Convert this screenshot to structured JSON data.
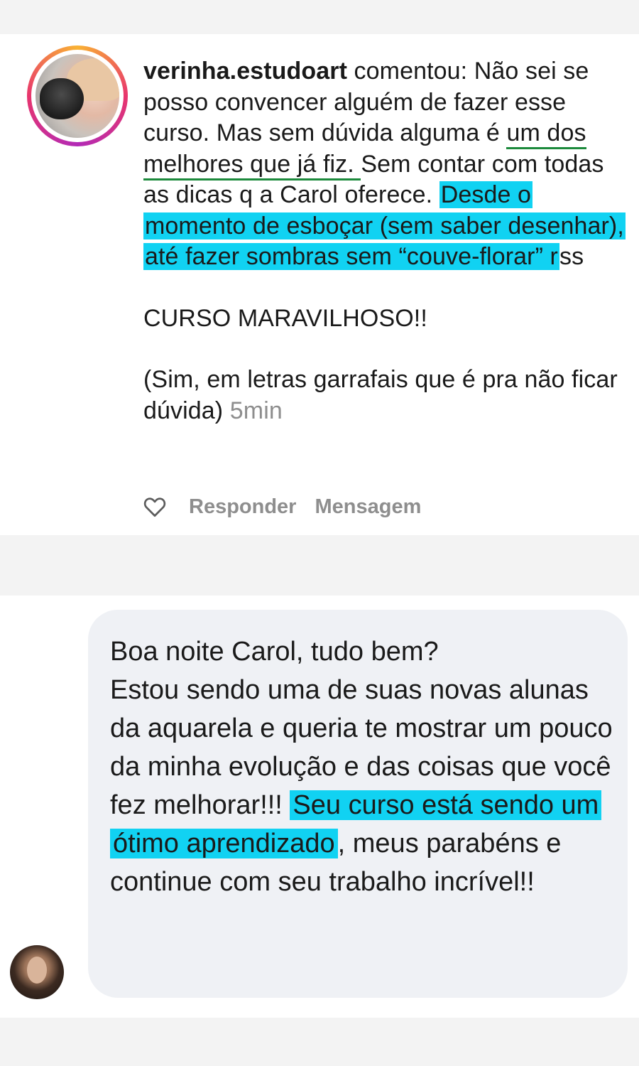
{
  "comment": {
    "username": "verinha.estudoart",
    "verb": " comentou: ",
    "text_1": "Não sei se posso convencer alguém de fazer esse curso. Mas sem dúvida alguma é ",
    "underlined": "um dos melhores que já fiz. ",
    "text_2": "Sem contar com todas as dicas q a Carol oferece. ",
    "highlighted": "Desde o momento de esboçar (sem saber desenhar), até fazer sombras sem “couve-florar” r",
    "text_3": "ss",
    "shout": "CURSO MARAVILHOSO!!",
    "aside": "(Sim, em letras garrafais que é pra não ficar dúvida) ",
    "time": "5min",
    "actions": {
      "reply": "Responder",
      "message": "Mensagem"
    }
  },
  "dm": {
    "greeting": "Boa noite Carol, tudo bem?",
    "text_1": "Estou sendo uma de suas novas alunas da aquarela e queria te mostrar um pouco da minha evolução e das coisas que você fez melhorar!!! ",
    "highlighted": "Seu curso está sendo um ótimo aprendizado",
    "text_2": ", meus parabéns e continue com seu trabalho incrível!!"
  },
  "colors": {
    "highlight": "#11d2f2",
    "underline": "#1c8a3c",
    "muted": "#8e8e8e",
    "bubble": "#eff1f5"
  },
  "icons": [
    "heart-icon"
  ]
}
